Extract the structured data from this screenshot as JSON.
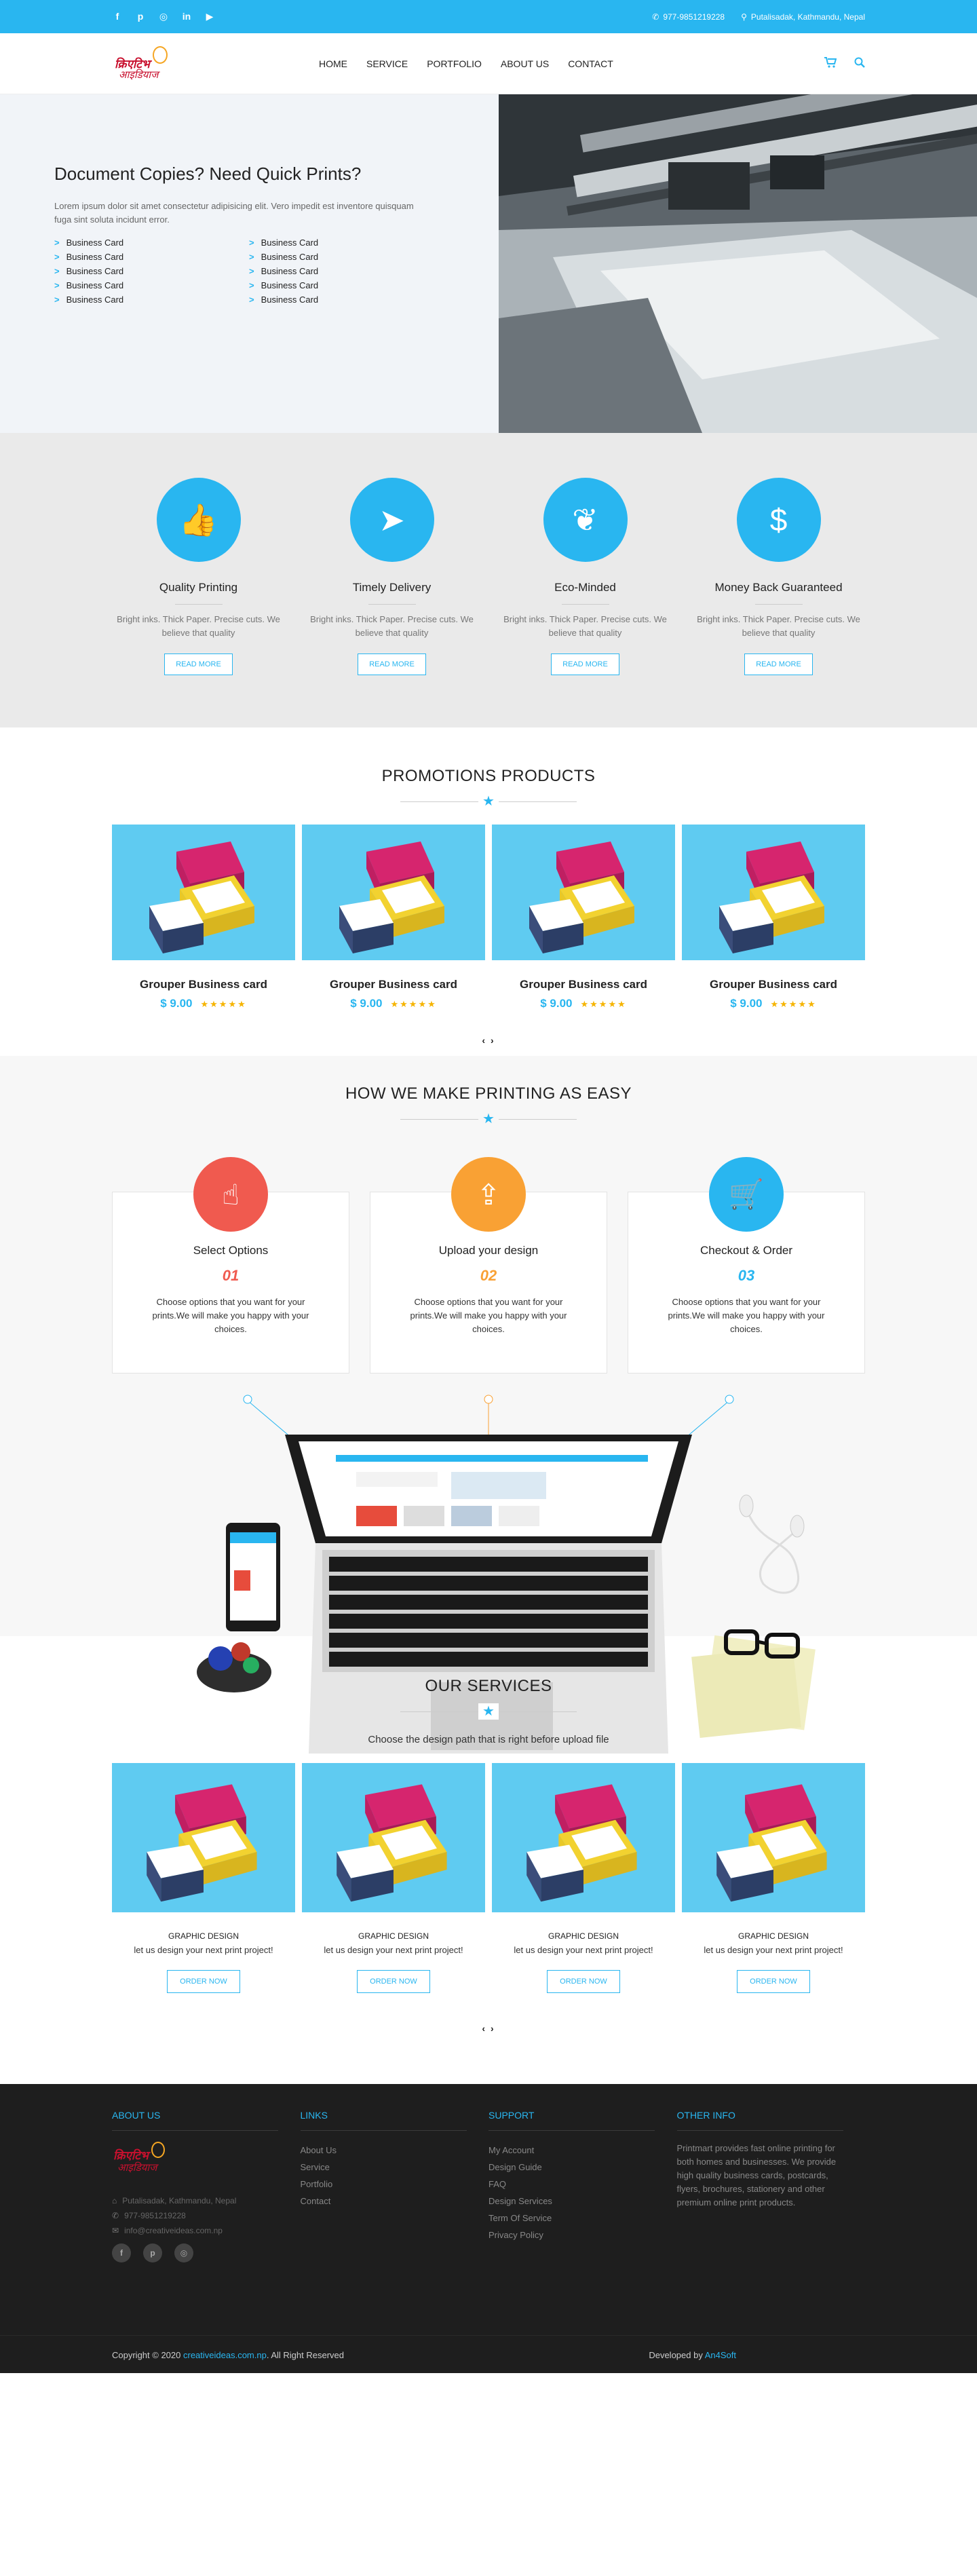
{
  "topbar": {
    "social": [
      "f",
      "p",
      "◎",
      "in",
      "▶"
    ],
    "phone": "977-9851219228",
    "address": "Putalisadak, Kathmandu, Nepal"
  },
  "nav": {
    "logo_line1": "क्रिएटिभ",
    "logo_line2": "आइडियाज",
    "items": [
      "HOME",
      "SERVICE",
      "PORTFOLIO",
      "ABOUT US",
      "CONTACT"
    ]
  },
  "hero": {
    "title": "Document Copies? Need Quick Prints?",
    "text": "Lorem ipsum dolor sit amet consectetur adipisicing elit. Vero impedit est inventore quisquam fuga sint soluta incidunt error.",
    "list": [
      "Business Card",
      "Business Card",
      "Business Card",
      "Business Card",
      "Business Card",
      "Business Card",
      "Business Card",
      "Business Card",
      "Business Card",
      "Business Card"
    ]
  },
  "features": [
    {
      "title": "Quality Printing",
      "text": "Bright inks. Thick Paper. Precise cuts. We believe that quality",
      "button": "READ MORE",
      "icon": "thumbs-up-icon",
      "glyph": "👍"
    },
    {
      "title": "Timely Delivery",
      "text": "Bright inks. Thick Paper. Precise cuts. We believe that quality",
      "button": "READ MORE",
      "icon": "paper-plane-icon",
      "glyph": "➤"
    },
    {
      "title": "Eco-Minded",
      "text": "Bright inks. Thick Paper. Precise cuts. We believe that quality",
      "button": "READ MORE",
      "icon": "leaf-icon",
      "glyph": "❦"
    },
    {
      "title": "Money Back Guaranteed",
      "text": "Bright inks. Thick Paper. Precise cuts. We believe that quality",
      "button": "READ MORE",
      "icon": "money-icon",
      "glyph": "$"
    }
  ],
  "promotions": {
    "title": "PROMOTIONS PRODUCTS",
    "products": [
      {
        "name": "Grouper Business card",
        "price": "$ 9.00",
        "rating": 5
      },
      {
        "name": "Grouper Business card",
        "price": "$ 9.00",
        "rating": 5
      },
      {
        "name": "Grouper Business card",
        "price": "$ 9.00",
        "rating": 5
      },
      {
        "name": "Grouper Business card",
        "price": "$ 9.00",
        "rating": 5
      }
    ],
    "arrows": "‹ ›"
  },
  "how": {
    "title": "HOW WE MAKE PRINTING AS EASY",
    "steps": [
      {
        "title": "Select Options",
        "num": "01",
        "color": "#f05a4f",
        "icon": "hand-pointer-icon",
        "glyph": "☝",
        "text": "Choose options that you want for your prints.We will make you happy with your choices."
      },
      {
        "title": "Upload your design",
        "num": "02",
        "color": "#f9a134",
        "icon": "upload-file-icon",
        "glyph": "⇪",
        "text": "Choose options that you want for your prints.We will make you happy with your choices."
      },
      {
        "title": "Checkout & Order",
        "num": "03",
        "color": "#29b6f0",
        "icon": "cart-icon",
        "glyph": "🛒",
        "text": "Choose options that you want for your prints.We will make you happy with your choices."
      }
    ]
  },
  "services": {
    "title": "OUR SERVICES",
    "subtitle": "Choose the design path that is right before upload file",
    "items": [
      {
        "name": "GRAPHIC DESIGN",
        "text": "let us design your next print project!",
        "button": "ORDER NOW"
      },
      {
        "name": "GRAPHIC DESIGN",
        "text": "let us design your next print project!",
        "button": "ORDER NOW"
      },
      {
        "name": "GRAPHIC DESIGN",
        "text": "let us design your next print project!",
        "button": "ORDER NOW"
      },
      {
        "name": "GRAPHIC DESIGN",
        "text": "let us design your next print project!",
        "button": "ORDER NOW"
      }
    ],
    "arrows": "‹ ›"
  },
  "footer": {
    "about": {
      "title": "ABOUT US",
      "address": "Putalisadak, Kathmandu, Nepal",
      "phone": "977-9851219228",
      "email": "info@creativeideas.com.np",
      "social": [
        "f",
        "p",
        "◎"
      ]
    },
    "links": {
      "title": "LINKS",
      "items": [
        "About Us",
        "Service",
        "Portfolio",
        "Contact"
      ]
    },
    "support": {
      "title": "SUPPORT",
      "items": [
        "My Account",
        "Design Guide",
        "FAQ",
        "Design Services",
        "Term Of Service",
        "Privacy Policy"
      ]
    },
    "other": {
      "title": "OTHER INFO",
      "text": "Printmart provides fast online printing for both homes and businesses. We provide high quality business cards, postcards, flyers, brochures, stationery and other premium online print products."
    },
    "copyright_prefix": "Copyright © 2020",
    "copyright_link": "creativeideas.com.np",
    "copyright_suffix": ". All Right Reserved",
    "dev_prefix": "Developed by",
    "dev_link": "An4Soft"
  }
}
